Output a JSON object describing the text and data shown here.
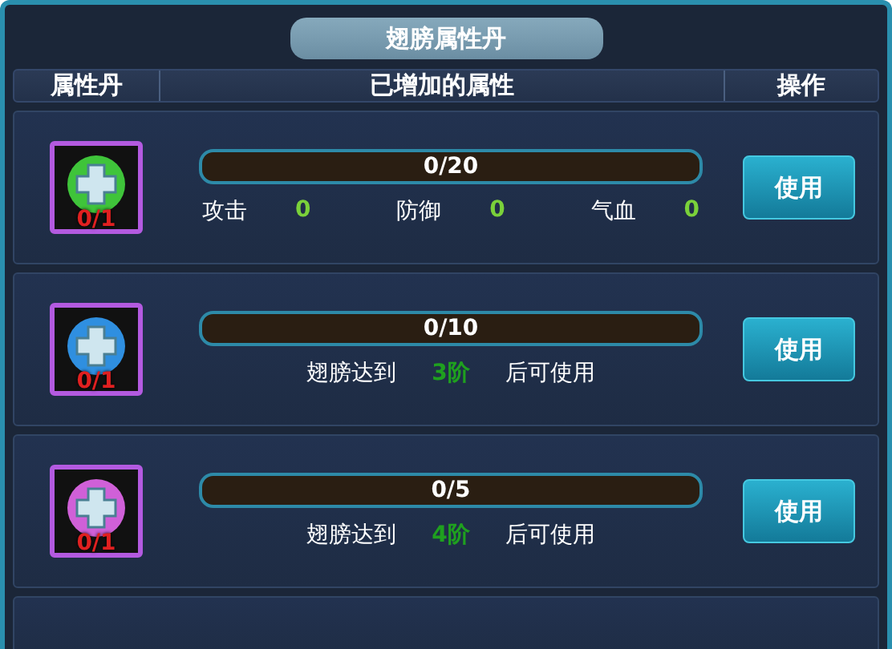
{
  "title": "翅膀属性丹",
  "columns": [
    "属性丹",
    "已增加的属性",
    "操作"
  ],
  "rows": [
    {
      "kind": "stats",
      "color": "#3fc43a",
      "count": "0/1",
      "progress": "0/20",
      "level": 0,
      "stats": [
        {
          "label": "攻击",
          "value": "0"
        },
        {
          "label": "防御",
          "value": "0"
        },
        {
          "label": "气血",
          "value": "0"
        }
      ],
      "button": "使用"
    },
    {
      "kind": "requirement",
      "color": "#2f8fe0",
      "count": "0/1",
      "progress": "0/10",
      "level": 0,
      "requirement": {
        "before": "翅膀达到",
        "tier": "3阶",
        "after": "后可使用"
      },
      "button": "使用"
    },
    {
      "kind": "requirement",
      "color": "#d060d8",
      "count": "0/1",
      "progress": "0/5",
      "level": 0,
      "requirement": {
        "before": "翅膀达到",
        "tier": "4阶",
        "after": "后可使用"
      },
      "button": "使用"
    }
  ]
}
